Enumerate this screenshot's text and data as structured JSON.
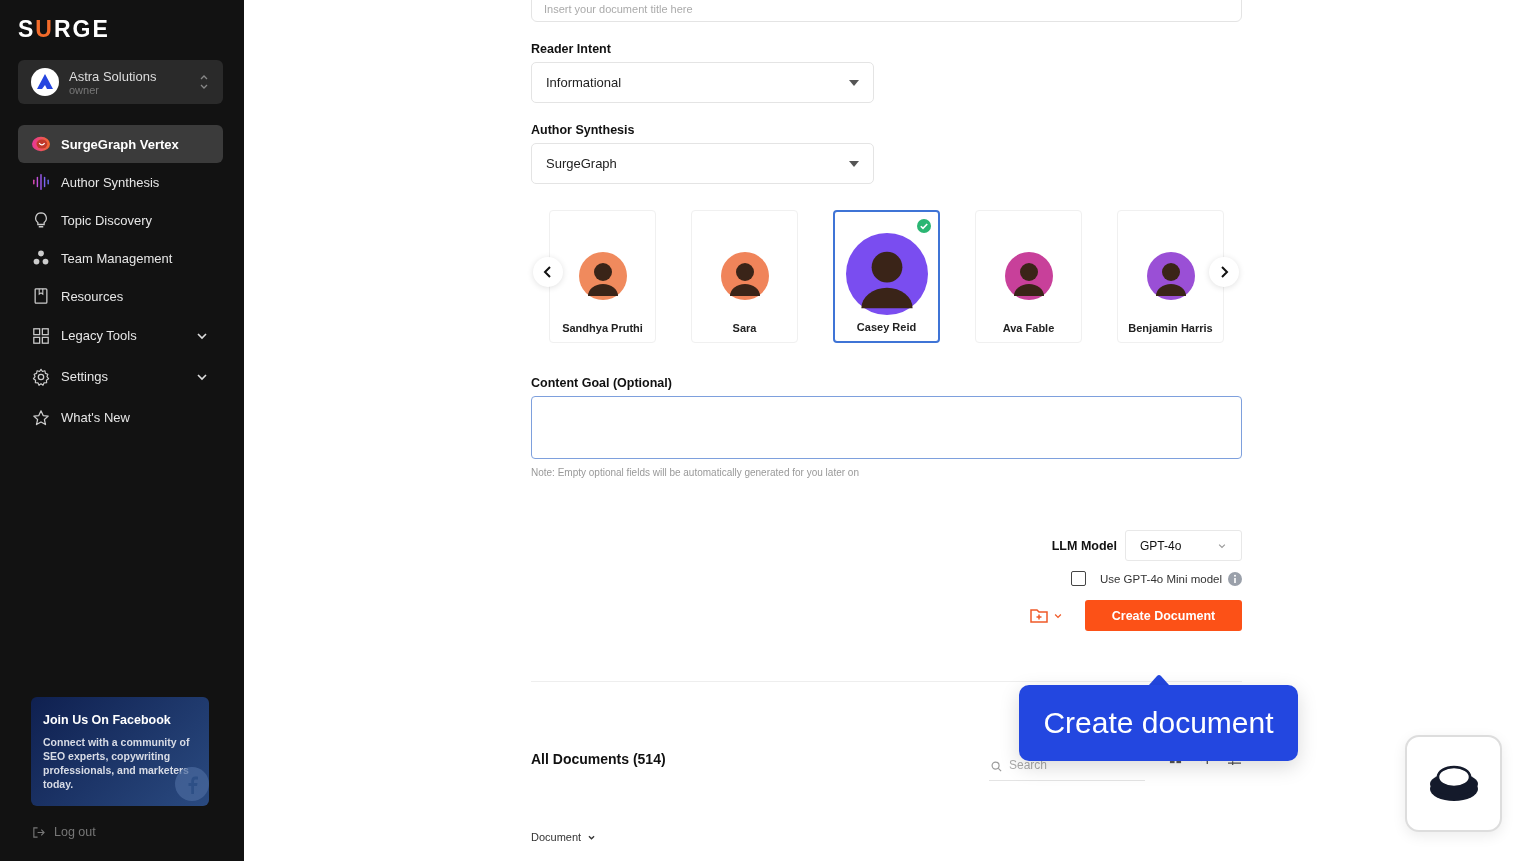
{
  "sidebar": {
    "logo": {
      "before": "S",
      "accent": "U",
      "after": "RGE"
    },
    "workspace": {
      "name": "Astra Solutions",
      "role": "owner"
    },
    "nav": [
      {
        "label": "SurgeGraph Vertex",
        "kind": "link",
        "selected": true
      },
      {
        "label": "Author Synthesis",
        "kind": "link",
        "selected": false
      },
      {
        "label": "Topic Discovery",
        "kind": "link",
        "selected": false
      },
      {
        "label": "Team Management",
        "kind": "link",
        "selected": false
      },
      {
        "label": "Resources",
        "kind": "link",
        "selected": false
      },
      {
        "label": "Legacy Tools",
        "kind": "group",
        "selected": false,
        "expanded": false
      },
      {
        "label": "Settings",
        "kind": "group",
        "selected": false,
        "expanded": false
      },
      {
        "label": "What's New",
        "kind": "link",
        "selected": false
      }
    ],
    "promo": {
      "title": "Join Us On Facebook",
      "text": "Connect with a community of SEO experts, copywriting professionals, and marketers today."
    },
    "logout": "Log out"
  },
  "form": {
    "title_field": {
      "placeholder": "Insert your document title here"
    },
    "reader_intent": {
      "label": "Reader Intent",
      "value": "Informational"
    },
    "author_synthesis": {
      "label": "Author Synthesis",
      "value": "SurgeGraph"
    },
    "authors": [
      {
        "name": "Sandhya Pruthi",
        "color": "#f08a5d",
        "selected": false
      },
      {
        "name": "Sara",
        "color": "#f0845a",
        "selected": false
      },
      {
        "name": "Casey Reid",
        "color": "#7a4df0",
        "selected": true
      },
      {
        "name": "Ava Fable",
        "color": "#c8409a",
        "selected": false
      },
      {
        "name": "Benjamin Harris",
        "color": "#9a4fd6",
        "selected": false
      }
    ],
    "content_goal": {
      "label": "Content Goal (Optional)"
    },
    "note": "Note: Empty optional fields will be automatically generated for you later on",
    "llm": {
      "label": "LLM Model",
      "value": "GPT-4o"
    },
    "mini": {
      "label": "Use GPT-4o Mini model",
      "checked": false
    },
    "create_button": "Create Document"
  },
  "documents": {
    "title": "All Documents (514)",
    "search_placeholder": "Search",
    "column": "Document"
  },
  "tooltip": "Create document"
}
